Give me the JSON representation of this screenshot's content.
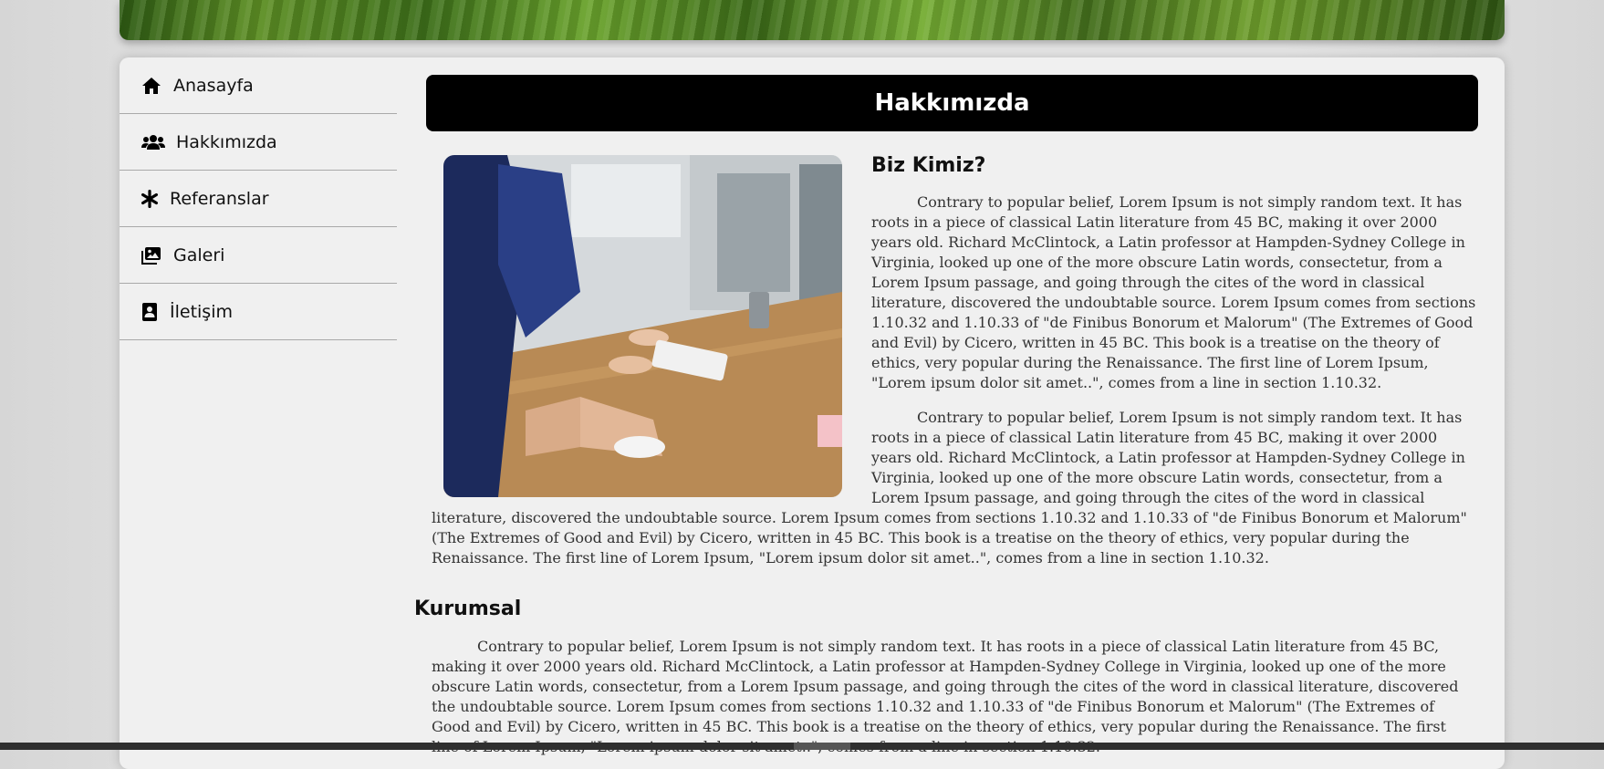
{
  "nav": {
    "items": [
      {
        "label": "Anasayfa",
        "icon": "home-icon"
      },
      {
        "label": "Hakkımızda",
        "icon": "users-icon"
      },
      {
        "label": "Referanslar",
        "icon": "asterisk-icon"
      },
      {
        "label": "Galeri",
        "icon": "images-icon"
      },
      {
        "label": "İletişim",
        "icon": "address-book-icon"
      }
    ]
  },
  "page": {
    "title": "Hakkımızda",
    "section1": {
      "heading": "Biz Kimiz?",
      "paragraphs": [
        "Contrary to popular belief, Lorem Ipsum is not simply random text. It has roots in a piece of classical Latin literature from 45 BC, making it over 2000 years old. Richard McClintock, a Latin professor at Hampden-Sydney College in Virginia, looked up one of the more obscure Latin words, consectetur, from a Lorem Ipsum passage, and going through the cites of the word in classical literature, discovered the undoubtable source. Lorem Ipsum comes from sections 1.10.32 and 1.10.33 of \"de Finibus Bonorum et Malorum\" (The Extremes of Good and Evil) by Cicero, written in 45 BC. This book is a treatise on the theory of ethics, very popular during the Renaissance. The first line of Lorem Ipsum, \"Lorem ipsum dolor sit amet..\", comes from a line in section 1.10.32.",
        "Contrary to popular belief, Lorem Ipsum is not simply random text. It has roots in a piece of classical Latin literature from 45 BC, making it over 2000 years old. Richard McClintock, a Latin professor at Hampden-Sydney College in Virginia, looked up one of the more obscure Latin words, consectetur, from a Lorem Ipsum passage, and going through the cites of the word in classical literature, discovered the undoubtable source. Lorem Ipsum comes from sections 1.10.32 and 1.10.33 of \"de Finibus Bonorum et Malorum\" (The Extremes of Good and Evil) by Cicero, written in 45 BC. This book is a treatise on the theory of ethics, very popular during the Renaissance. The first line of Lorem Ipsum, \"Lorem ipsum dolor sit amet..\", comes from a line in section 1.10.32."
      ]
    },
    "section2": {
      "heading": "Kurumsal",
      "paragraph": "Contrary to popular belief, Lorem Ipsum is not simply random text. It has roots in a piece of classical Latin literature from 45 BC, making it over 2000 years old. Richard McClintock, a Latin professor at Hampden-Sydney College in Virginia, looked up one of the more obscure Latin words, consectetur, from a Lorem Ipsum passage, and going through the cites of the word in classical literature, discovered the undoubtable source. Lorem Ipsum comes from sections 1.10.32 and 1.10.33 of \"de Finibus Bonorum et Malorum\" (The Extremes of Good and Evil) by Cicero, written in 45 BC. This book is a treatise on the theory of ethics, very popular during the Renaissance. The first line of Lorem Ipsum, \"Lorem ipsum dolor sit amet..\", comes from a line in section 1.10.32."
    }
  }
}
